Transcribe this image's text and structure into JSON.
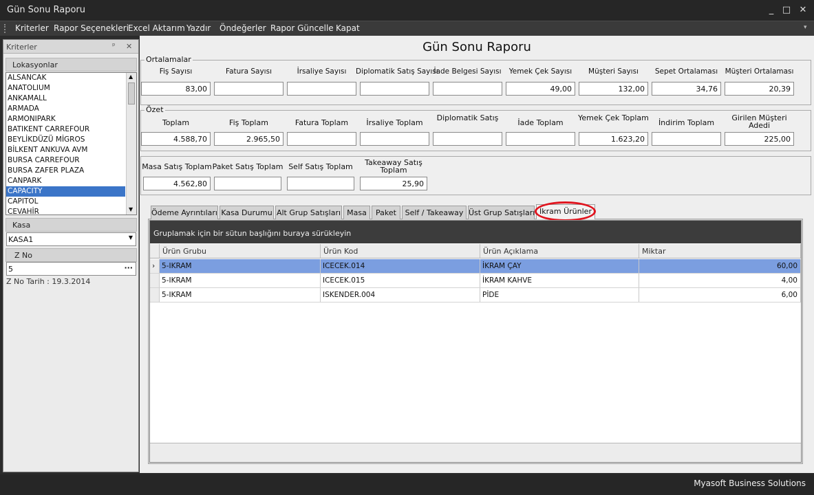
{
  "window": {
    "title": "Gün Sonu Raporu",
    "min": "_",
    "max": "□",
    "close": "✕"
  },
  "menu": [
    "Kriterler",
    "Rapor Seçenekleri",
    "Excel Aktarım",
    "Yazdır",
    "Öndeğerler",
    "Rapor Güncelle",
    "Kapat"
  ],
  "left": {
    "panel_title": "Kriterler",
    "pin": "ᵖ",
    "close": "✕",
    "locations_label": "Lokasyonlar",
    "locations": [
      "ALSANCAK",
      "ANATOLIUM",
      "ANKAMALL",
      "ARMADA",
      "ARMONIPARK",
      "BATIKENT CARREFOUR",
      "BEYLİKDÜZÜ MİGROS",
      "BİLKENT ANKUVA AVM",
      "BURSA CARREFOUR",
      "BURSA ZAFER PLAZA",
      "CANPARK",
      "CAPACITY",
      "CAPITOL",
      "CEVAHİR"
    ],
    "selected_location": "CAPACITY",
    "kasa_label": "Kasa",
    "kasa_value": "KASA1",
    "zno_label": "Z No",
    "zno_value": "5",
    "zno_date": "Z No Tarih : 19.3.2014"
  },
  "report": {
    "title": "Gün Sonu Raporu",
    "ortalamalar": {
      "label": "Ortalamalar",
      "fields": [
        {
          "label": "Fiş Sayısı",
          "value": "83,00"
        },
        {
          "label": "Fatura Sayısı",
          "value": ""
        },
        {
          "label": "İrsaliye Sayısı",
          "value": ""
        },
        {
          "label": "Diplomatik Satış Sayısı",
          "value": ""
        },
        {
          "label": "İade Belgesi Sayısı",
          "value": ""
        },
        {
          "label": "Yemek Çek Sayısı",
          "value": "49,00"
        },
        {
          "label": "Müşteri Sayısı",
          "value": "132,00"
        },
        {
          "label": "Sepet Ortalaması",
          "value": "34,76"
        },
        {
          "label": "Müşteri Ortalaması",
          "value": "20,39"
        }
      ]
    },
    "ozet": {
      "label": "Özet",
      "fields": [
        {
          "label": "Toplam",
          "value": "4.588,70"
        },
        {
          "label": "Fiş Toplam",
          "value": "2.965,50"
        },
        {
          "label": "Fatura Toplam",
          "value": ""
        },
        {
          "label": "İrsaliye Toplam",
          "value": ""
        },
        {
          "label": "Diplomatik Satış",
          "value": ""
        },
        {
          "label": "İade Toplam",
          "value": ""
        },
        {
          "label": "Yemek Çek Toplam",
          "value": "1.623,20"
        },
        {
          "label": "İndirim Toplam",
          "value": ""
        },
        {
          "label": "Girilen Müşteri Adedi",
          "value": "225,00"
        }
      ]
    },
    "satis": {
      "fields": [
        {
          "label": "Masa Satış Toplam",
          "value": "4.562,80"
        },
        {
          "label": "Paket Satış Toplam",
          "value": ""
        },
        {
          "label": "Self Satış Toplam",
          "value": ""
        },
        {
          "label": "Takeaway Satış Toplam",
          "value": "25,90"
        }
      ]
    }
  },
  "tabs": [
    "Ödeme Ayrıntıları",
    "Kasa Durumu",
    "Alt Grup Satışları",
    "Masa",
    "Paket",
    "Self / Takeaway",
    "Üst Grup Satışları",
    "İkram Ürünler"
  ],
  "active_tab": "İkram Ürünler",
  "highlight_color": "#e0141e",
  "grid": {
    "group_hint": "Gruplamak için bir sütun başlığını buraya sürükleyin",
    "columns": [
      "Ürün Grubu",
      "Ürün Kod",
      "Ürün Açıklama",
      "Miktar"
    ],
    "rows": [
      [
        "5-IKRAM",
        "ICECEK.014",
        "İKRAM ÇAY",
        "60,00"
      ],
      [
        "5-IKRAM",
        "ICECEK.015",
        "İKRAM KAHVE",
        "4,00"
      ],
      [
        "5-IKRAM",
        "ISKENDER.004",
        "PİDE",
        "6,00"
      ]
    ],
    "row_indicator": "›"
  },
  "status": {
    "company": "Myasoft Business Solutions"
  }
}
